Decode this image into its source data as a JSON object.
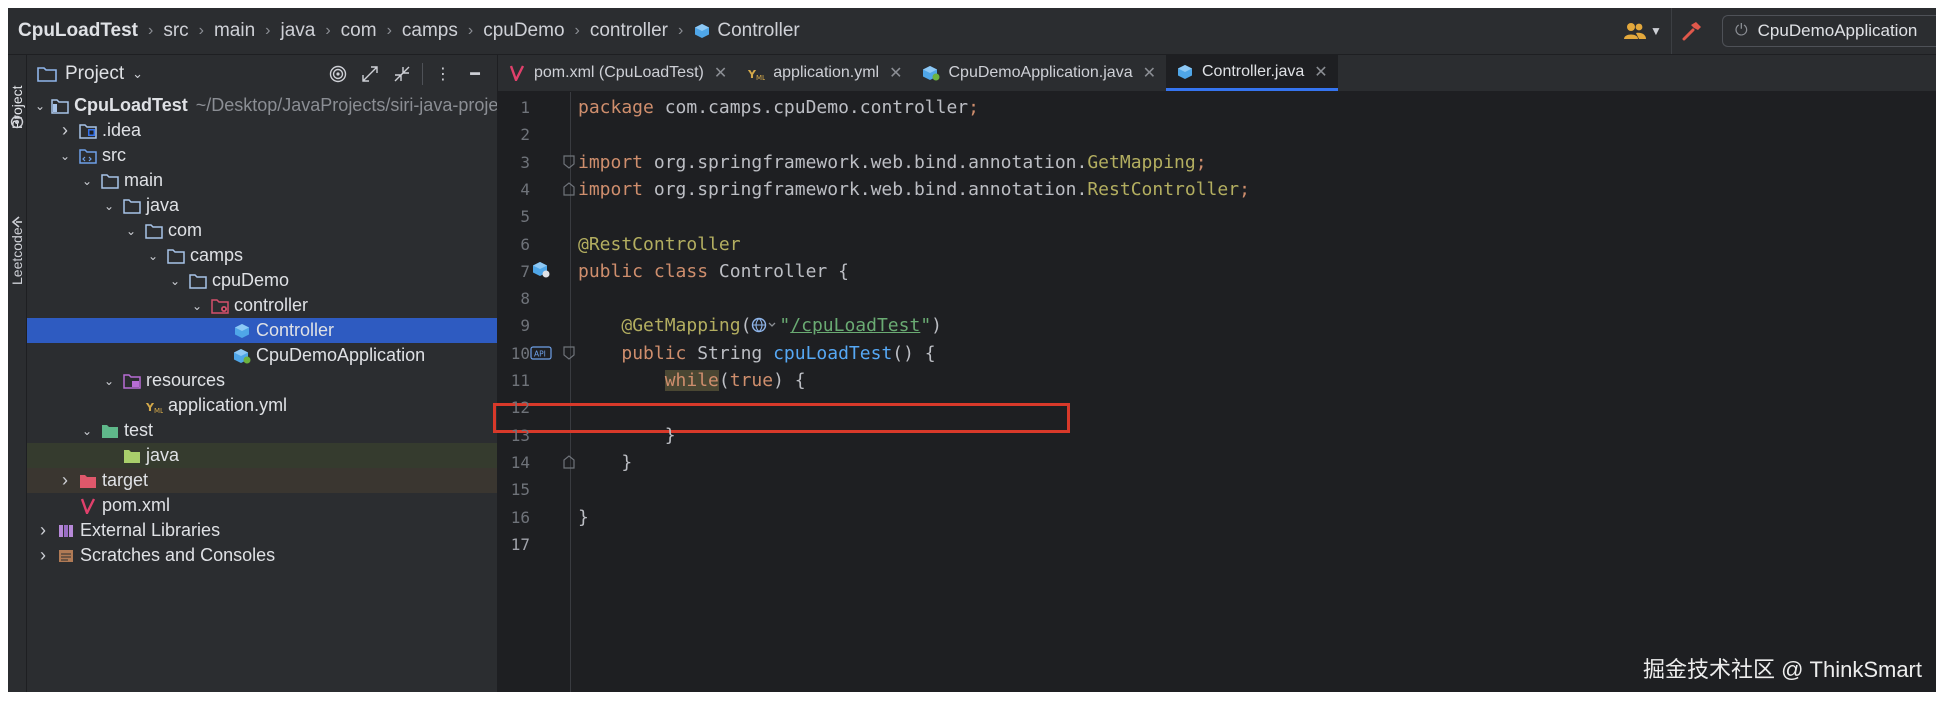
{
  "navbar": {
    "breadcrumbs": [
      {
        "label": "CpuLoadTest",
        "bold": true
      },
      {
        "label": "src"
      },
      {
        "label": "main"
      },
      {
        "label": "java"
      },
      {
        "label": "com"
      },
      {
        "label": "camps"
      },
      {
        "label": "cpuDemo"
      },
      {
        "label": "controller"
      },
      {
        "label": "Controller",
        "icon": "class-icon"
      }
    ],
    "run_config_label": "CpuDemoApplication"
  },
  "toolstrip": {
    "project_tab": "Project",
    "leetcode_tab": "Leetcode"
  },
  "project_panel": {
    "title": "Project",
    "tree": [
      {
        "label": "CpuLoadTest",
        "path": "~/Desktop/JavaProjects/siri-java-projec",
        "icon": "module-folder-icon",
        "expanded": true
      },
      {
        "label": ".idea",
        "icon": "idea-folder-icon",
        "expanded": false
      },
      {
        "label": "src",
        "icon": "source-root-icon",
        "expanded": true
      },
      {
        "label": "main",
        "icon": "folder-icon",
        "expanded": true
      },
      {
        "label": "java",
        "icon": "folder-icon",
        "expanded": true
      },
      {
        "label": "com",
        "icon": "folder-icon",
        "expanded": true
      },
      {
        "label": "camps",
        "icon": "folder-icon",
        "expanded": true
      },
      {
        "label": "cpuDemo",
        "icon": "folder-icon",
        "expanded": true
      },
      {
        "label": "controller",
        "icon": "package-config-icon",
        "expanded": true
      },
      {
        "label": "Controller",
        "icon": "class-icon",
        "selected": true
      },
      {
        "label": "CpuDemoApplication",
        "icon": "spring-class-icon"
      },
      {
        "label": "resources",
        "icon": "resources-folder-icon",
        "expanded": true
      },
      {
        "label": "application.yml",
        "icon": "yaml-file-icon"
      },
      {
        "label": "test",
        "icon": "test-folder-icon",
        "expanded": true
      },
      {
        "label": "java",
        "icon": "test-source-root-icon"
      },
      {
        "label": "target",
        "icon": "excluded-folder-icon",
        "expanded": false
      },
      {
        "label": "pom.xml",
        "icon": "maven-icon"
      },
      {
        "label": "External Libraries",
        "icon": "libraries-icon",
        "expanded": false
      },
      {
        "label": "Scratches and Consoles",
        "icon": "scratches-icon",
        "expanded": false
      }
    ]
  },
  "editor": {
    "tabs": [
      {
        "label": "pom.xml (CpuLoadTest)",
        "icon": "maven-icon",
        "active": false
      },
      {
        "label": "application.yml",
        "icon": "yaml-file-icon",
        "active": false
      },
      {
        "label": "CpuDemoApplication.java",
        "icon": "spring-class-icon",
        "active": false
      },
      {
        "label": "Controller.java",
        "icon": "class-icon",
        "active": true
      }
    ],
    "lines": [
      {
        "n": "1",
        "tokens": [
          {
            "t": "package ",
            "c": "kw"
          },
          {
            "t": "com.camps.cpuDemo.controller",
            "c": ""
          },
          {
            "t": ";",
            "c": "kw"
          }
        ]
      },
      {
        "n": "2",
        "tokens": []
      },
      {
        "n": "3",
        "tokens": [
          {
            "t": "import ",
            "c": "kw"
          },
          {
            "t": "org.springframework.web.bind.annotation.",
            "c": ""
          },
          {
            "t": "GetMapping",
            "c": "ann"
          },
          {
            "t": ";",
            "c": "kw"
          }
        ]
      },
      {
        "n": "4",
        "tokens": [
          {
            "t": "import ",
            "c": "kw"
          },
          {
            "t": "org.springframework.web.bind.annotation.",
            "c": ""
          },
          {
            "t": "RestController",
            "c": "ann"
          },
          {
            "t": ";",
            "c": "kw"
          }
        ]
      },
      {
        "n": "5",
        "tokens": []
      },
      {
        "n": "6",
        "tokens": [
          {
            "t": "@RestController",
            "c": "ann"
          }
        ]
      },
      {
        "n": "7",
        "tokens": [
          {
            "t": "public class ",
            "c": "kw"
          },
          {
            "t": "Controller {",
            "c": ""
          }
        ]
      },
      {
        "n": "8",
        "tokens": []
      },
      {
        "n": "9",
        "tokens": [
          {
            "t": "    ",
            "c": ""
          },
          {
            "t": "@GetMapping",
            "c": "ann"
          },
          {
            "t": "(",
            "c": ""
          },
          {
            "t": "🌐⌄",
            "c": "globe"
          },
          {
            "t": "\"",
            "c": "str"
          },
          {
            "t": "/cpuLoadTest",
            "c": "url-str"
          },
          {
            "t": "\"",
            "c": "str"
          },
          {
            "t": ")",
            "c": ""
          }
        ]
      },
      {
        "n": "10",
        "tokens": [
          {
            "t": "    ",
            "c": ""
          },
          {
            "t": "public ",
            "c": "kw"
          },
          {
            "t": "String ",
            "c": ""
          },
          {
            "t": "cpuLoadTest",
            "c": "fn"
          },
          {
            "t": "() {",
            "c": ""
          }
        ]
      },
      {
        "n": "11",
        "tokens": [
          {
            "t": "        ",
            "c": ""
          },
          {
            "t": "while",
            "c": "while-hl"
          },
          {
            "t": "(",
            "c": ""
          },
          {
            "t": "true",
            "c": "kw"
          },
          {
            "t": ") {",
            "c": ""
          }
        ]
      },
      {
        "n": "12",
        "tokens": []
      },
      {
        "n": "13",
        "tokens": [
          {
            "t": "        }",
            "c": ""
          }
        ]
      },
      {
        "n": "14",
        "tokens": [
          {
            "t": "    }",
            "c": ""
          }
        ]
      },
      {
        "n": "15",
        "tokens": []
      },
      {
        "n": "16",
        "tokens": [
          {
            "t": "}",
            "c": ""
          }
        ]
      },
      {
        "n": "17",
        "tokens": []
      }
    ],
    "current_line": "17"
  },
  "watermark": "掘金技术社区 @ ThinkSmart",
  "colors": {
    "background": "#1e1f22",
    "panel": "#2b2d30",
    "selection": "#2e5bc1",
    "keyword": "#cf8e6d",
    "annotation": "#b3ae60",
    "string": "#6aab73",
    "function": "#56a8f5",
    "highlight_box": "#d8392a"
  }
}
